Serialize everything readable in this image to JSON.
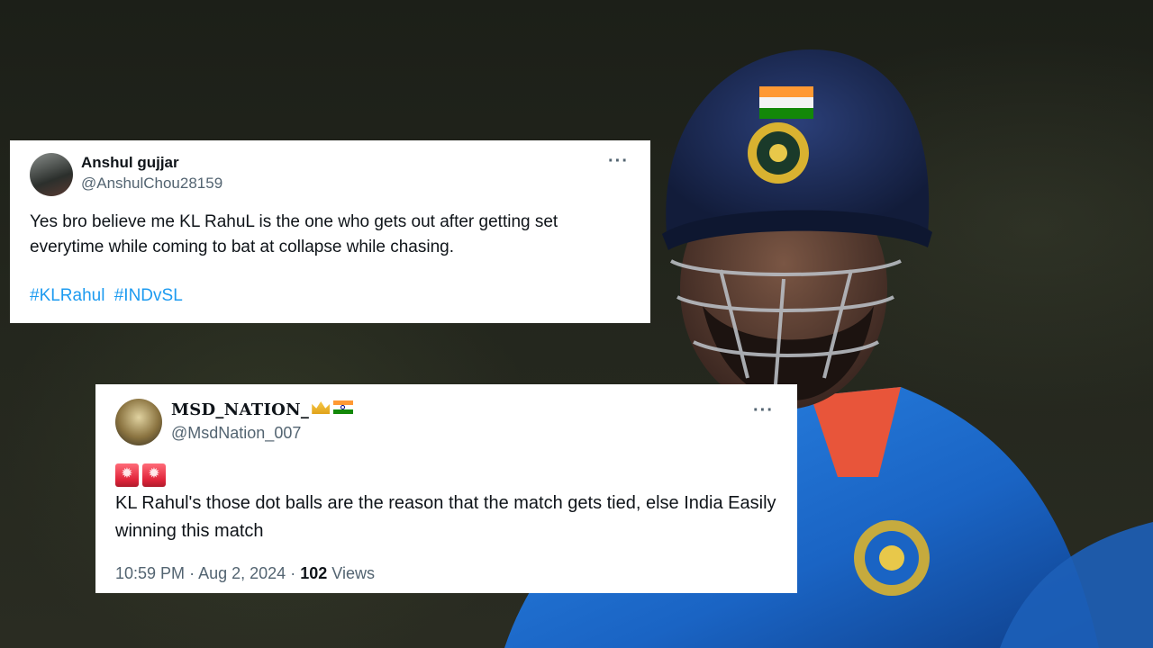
{
  "tweets": [
    {
      "author_name": "Anshul gujjar",
      "handle": "@AnshulChou28159",
      "text": "Yes bro believe me KL RahuL is the one who gets out after getting set everytime while coming to bat at collapse while chasing.",
      "hashtags": [
        "#KLRahul",
        "#INDvSL"
      ],
      "more_label": "···"
    },
    {
      "author_name": "MSD_NATION_",
      "handle": "@MsdNation_007",
      "text": "KL Rahul's those dot balls are the reason that the match gets tied, else India Easily winning this match",
      "emoji": [
        "siren-icon",
        "siren-icon"
      ],
      "name_badges": [
        "crown-icon",
        "india-flag-icon"
      ],
      "time": "10:59 PM",
      "date": "Aug 2, 2024",
      "views_count": "102",
      "views_label": "Views",
      "separator": "·",
      "more_label": "···"
    }
  ],
  "colors": {
    "hashtag": "#1d9bf0",
    "secondary_text": "#536471",
    "jersey": "#1e6fd0",
    "helmet": "#1a2a52"
  }
}
